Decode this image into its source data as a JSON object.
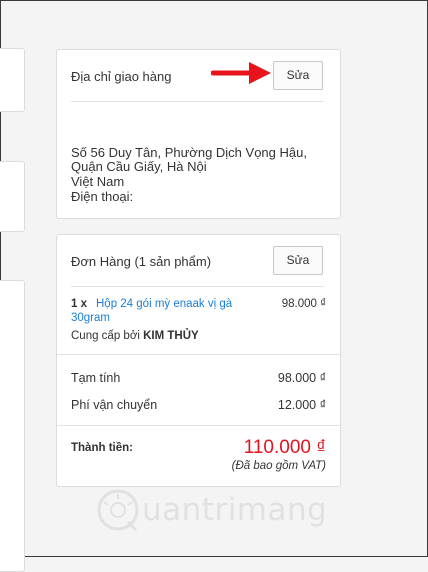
{
  "address_card": {
    "title": "Địa chỉ giao hàng",
    "edit_label": "Sửa",
    "lines": [
      "Số 56 Duy Tân, Phường Dịch Vọng Hậu,",
      "Quận Cầu Giấy, Hà Nội",
      "Việt Nam",
      "Điện thoại:"
    ]
  },
  "order_card": {
    "title": "Đơn Hàng (1 sản phẩm)",
    "edit_label": "Sửa",
    "item": {
      "qty": "1 x",
      "name_line1": "Hộp 24 gói mỳ enaak vị gà",
      "name_line2": "30gram",
      "price": "98.000 ₫",
      "supplier_prefix": "Cung cấp bởi",
      "supplier_name": "KIM THỦY"
    },
    "subtotal_label": "Tạm tính",
    "subtotal_value": "98.000 ₫",
    "shipping_label": "Phí vận chuyển",
    "shipping_value": "12.000 ₫",
    "total_label": "Thành tiền:",
    "total_value": "110.000 ₫",
    "vat_note": "(Đã bao gồm VAT)"
  },
  "colors": {
    "accent_red": "#e5131d",
    "link_blue": "#1a7fd4",
    "arrow_red": "#e8141b"
  },
  "watermark": {
    "text": "uantrimang",
    "logo_name": "quantrimang-logo-icon"
  }
}
